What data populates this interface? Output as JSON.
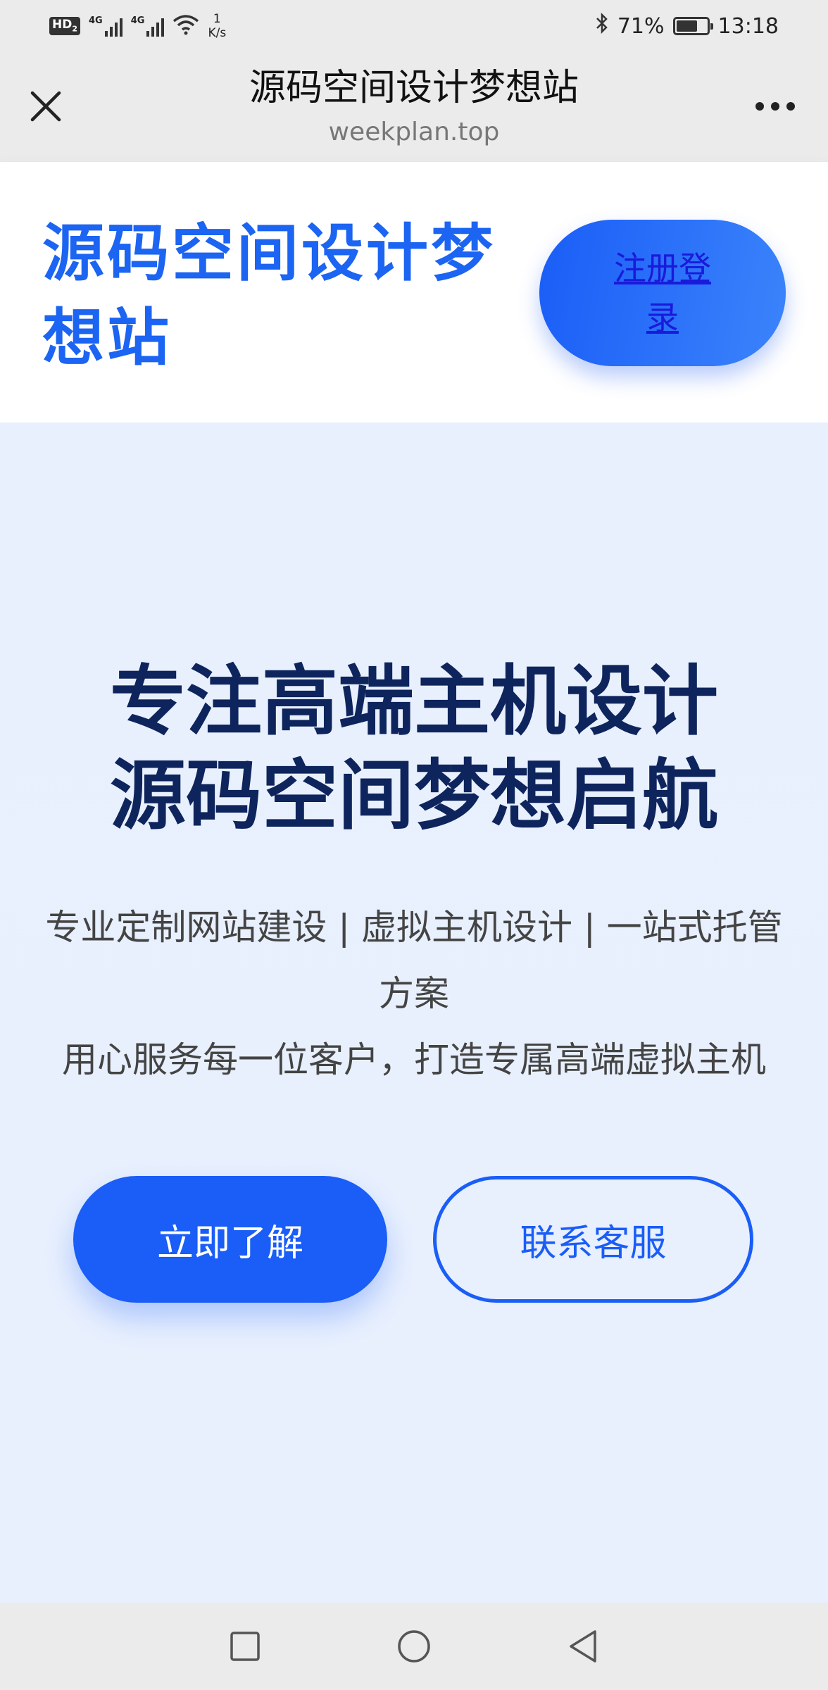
{
  "status_bar": {
    "hd_label": "HD",
    "hd_sub": "2",
    "sim1_label": "4G",
    "sim2_label": "4G",
    "net_speed_value": "1",
    "net_speed_unit": "K/s",
    "battery_percent": "71%",
    "battery_level": 0.71,
    "time": "13:18"
  },
  "browser": {
    "title": "源码空间设计梦想站",
    "url": "weekplan.top"
  },
  "header": {
    "brand": "源码空间设计梦想站",
    "login_link": "注册登录"
  },
  "hero": {
    "heading_line1": "专注高端主机设计",
    "heading_line2": "源码空间梦想启航",
    "subtitle_line1": "专业定制网站建设 | 虚拟主机设计 | 一站式托管方案",
    "subtitle_line2": "用心服务每一位客户，打造专属高端虚拟主机",
    "primary_button": "立即了解",
    "secondary_button": "联系客服"
  },
  "colors": {
    "accent": "#1a5df7",
    "heading": "#0e245c",
    "hero_bg": "#e9f0fd"
  },
  "icons": {
    "close": "close-icon",
    "more": "more-dots-icon",
    "bluetooth": "bluetooth-icon",
    "wifi": "wifi-icon",
    "nav_recent": "square-icon",
    "nav_home": "circle-icon",
    "nav_back": "triangle-back-icon"
  }
}
